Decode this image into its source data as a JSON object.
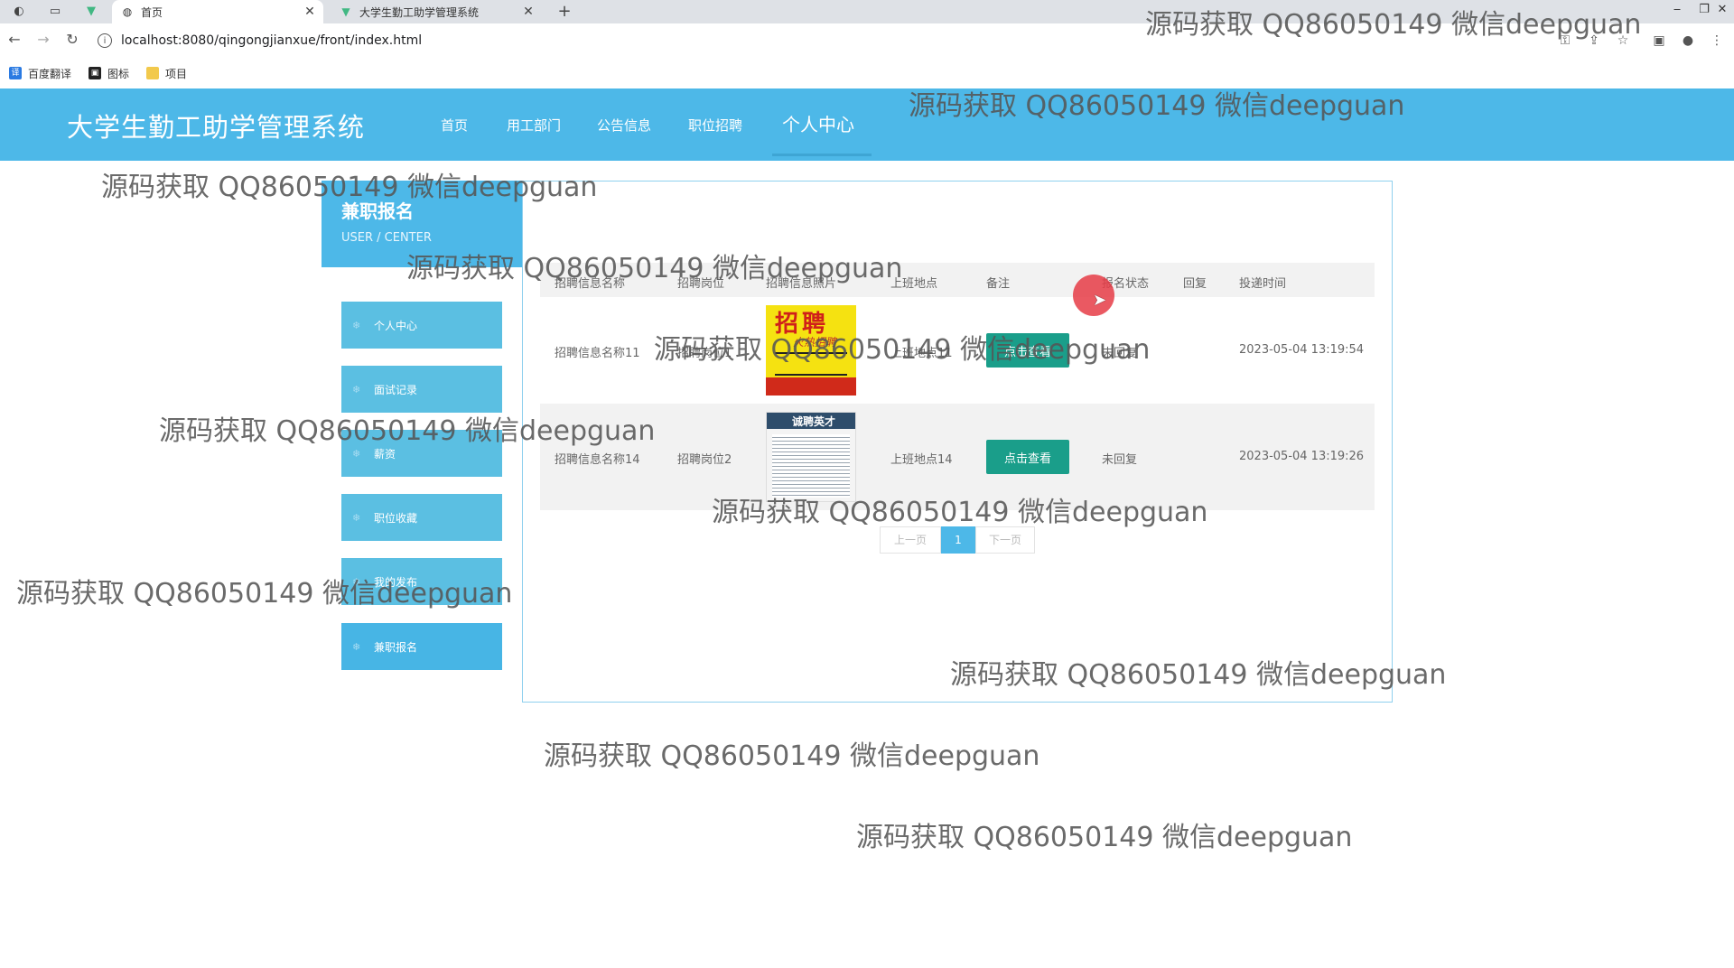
{
  "browser": {
    "tabs": [
      {
        "title": "首页",
        "active": true
      },
      {
        "title": "大学生勤工助学管理系统",
        "active": false
      }
    ],
    "url": "localhost:8080/qingongjianxue/front/index.html",
    "bookmarks": [
      "百度翻译",
      "图标",
      "项目"
    ]
  },
  "site": {
    "title": "大学生勤工助学管理系统",
    "nav": [
      "首页",
      "用工部门",
      "公告信息",
      "职位招聘",
      "个人中心"
    ],
    "active_nav": "个人中心"
  },
  "sidebar": {
    "heading": "兼职报名",
    "subheading": "USER / CENTER",
    "items": [
      "个人中心",
      "面试记录",
      "薪资",
      "职位收藏",
      "我的发布",
      "兼职报名"
    ],
    "active_item": "兼职报名"
  },
  "table": {
    "headers": [
      "招聘信息名称",
      "招聘岗位",
      "招聘信息照片",
      "上班地点",
      "备注",
      "报名状态",
      "回复",
      "投递时间"
    ],
    "rows": [
      {
        "name": "招聘信息名称11",
        "position": "招聘岗位1",
        "photo_text": "招聘",
        "photo_sub": "火热招聘",
        "location": "上班地点11",
        "action": "点击查看",
        "status": "未回复",
        "reply": "",
        "time": "2023-05-04 13:19:54"
      },
      {
        "name": "招聘信息名称14",
        "position": "招聘岗位2",
        "photo_text": "诚聘英才",
        "location": "上班地点14",
        "action": "点击查看",
        "status": "未回复",
        "reply": "",
        "time": "2023-05-04 13:19:26"
      }
    ]
  },
  "pagination": {
    "prev": "上一页",
    "current": "1",
    "next": "下一页"
  },
  "watermark": "源码获取 QQ86050149 微信deepguan",
  "colors": {
    "header": "#4db8e8",
    "sidebar_item": "#5bbfe2",
    "button": "#1a9e8a"
  }
}
